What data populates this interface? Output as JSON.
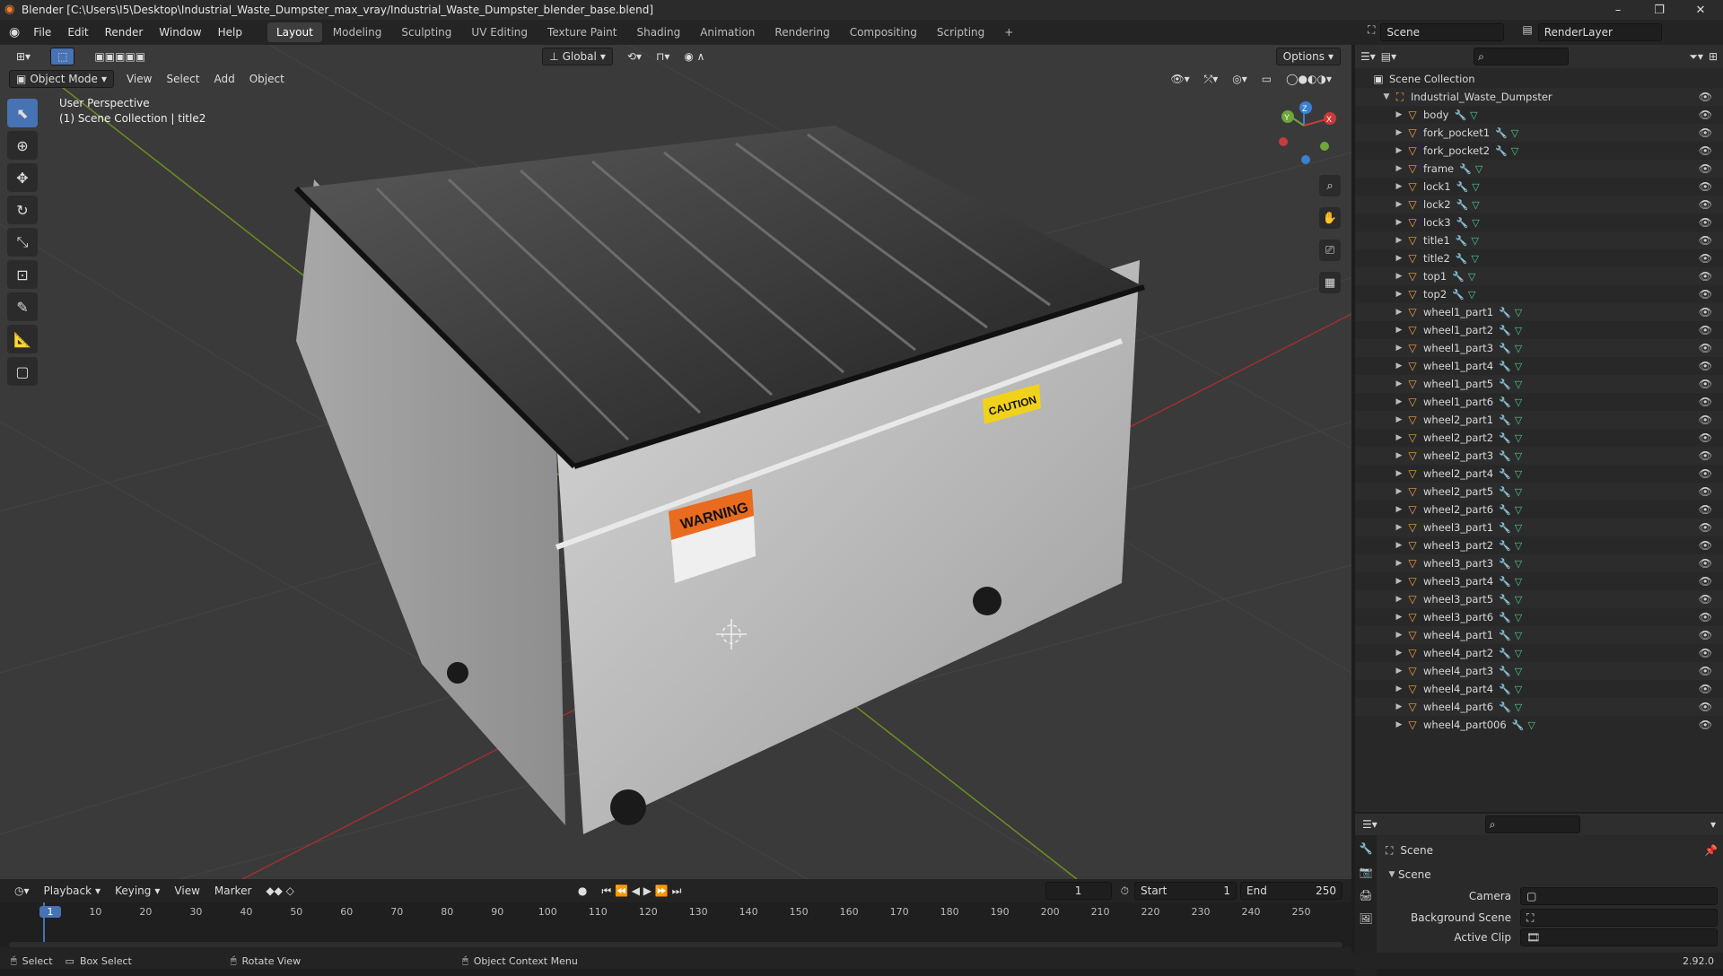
{
  "window": {
    "title": "Blender [C:\\Users\\I5\\Desktop\\Industrial_Waste_Dumpster_max_vray/Industrial_Waste_Dumpster_blender_base.blend]",
    "minimize": "–",
    "maximize": "❐",
    "close": "✕"
  },
  "menu": {
    "items": [
      "File",
      "Edit",
      "Render",
      "Window",
      "Help"
    ]
  },
  "workspaces": [
    "Layout",
    "Modeling",
    "Sculpting",
    "UV Editing",
    "Texture Paint",
    "Shading",
    "Animation",
    "Rendering",
    "Compositing",
    "Scripting"
  ],
  "workspace_add": "+",
  "scene": {
    "name": "Scene",
    "view_layer": "RenderLayer"
  },
  "viewport": {
    "mode": "Object Mode",
    "menus": [
      "View",
      "Select",
      "Add",
      "Object"
    ],
    "transform": "Global",
    "options": "Options",
    "overlay_line1": "User Perspective",
    "overlay_line2": "(1) Scene Collection | title2",
    "gizmo": {
      "x": "X",
      "y": "Y",
      "z": "Z"
    },
    "labels": {
      "warning": "WARNING",
      "caution": "CAUTION"
    }
  },
  "outliner": {
    "search_placeholder": "",
    "root": "Scene Collection",
    "collection": "Industrial_Waste_Dumpster",
    "objects": [
      "body",
      "fork_pocket1",
      "fork_pocket2",
      "frame",
      "lock1",
      "lock2",
      "lock3",
      "title1",
      "title2",
      "top1",
      "top2",
      "wheel1_part1",
      "wheel1_part2",
      "wheel1_part3",
      "wheel1_part4",
      "wheel1_part5",
      "wheel1_part6",
      "wheel2_part1",
      "wheel2_part2",
      "wheel2_part3",
      "wheel2_part4",
      "wheel2_part5",
      "wheel2_part6",
      "wheel3_part1",
      "wheel3_part2",
      "wheel3_part3",
      "wheel3_part4",
      "wheel3_part5",
      "wheel3_part6",
      "wheel4_part1",
      "wheel4_part2",
      "wheel4_part3",
      "wheel4_part4",
      "wheel4_part6",
      "wheel4_part006"
    ]
  },
  "properties": {
    "breadcrumb": "Scene",
    "panel": "Scene",
    "camera_label": "Camera",
    "background_label": "Background Scene",
    "active_clip_label": "Active Clip"
  },
  "timeline": {
    "menus": [
      "Playback",
      "Keying",
      "View",
      "Marker"
    ],
    "current_frame": "1",
    "start_label": "Start",
    "start": "1",
    "end_label": "End",
    "end": "250",
    "ticks": [
      "1",
      "10",
      "20",
      "30",
      "40",
      "50",
      "60",
      "70",
      "80",
      "90",
      "100",
      "110",
      "120",
      "130",
      "140",
      "150",
      "160",
      "170",
      "180",
      "190",
      "200",
      "210",
      "220",
      "230",
      "240",
      "250"
    ]
  },
  "status": {
    "select": "Select",
    "box_select": "Box Select",
    "rotate": "Rotate View",
    "context": "Object Context Menu",
    "version": "2.92.0"
  },
  "colors": {
    "accent": "#4772b3",
    "object": "#f0a040",
    "modifier": "#6a9ee0",
    "mesh": "#4ecb8a"
  }
}
